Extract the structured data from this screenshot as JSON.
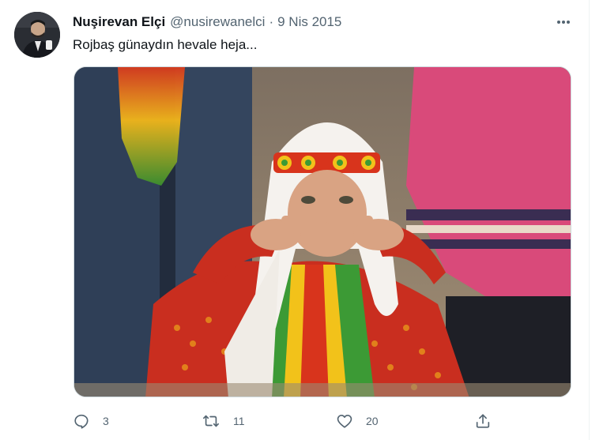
{
  "author": {
    "display_name": "Nuşirevan Elçi",
    "handle": "@nusirewanelci",
    "separator": "·",
    "date": "9 Nis 2015"
  },
  "tweet": {
    "text": "Rojbaş günaydın hevale heja..."
  },
  "actions": {
    "reply": {
      "icon": "reply-icon",
      "count": "3"
    },
    "retweet": {
      "icon": "retweet-icon",
      "count": "11"
    },
    "like": {
      "icon": "heart-icon",
      "count": "20"
    },
    "share": {
      "icon": "share-icon"
    }
  },
  "colors": {
    "text_primary": "#0f1419",
    "text_secondary": "#536471",
    "border": "#cfd9de"
  }
}
